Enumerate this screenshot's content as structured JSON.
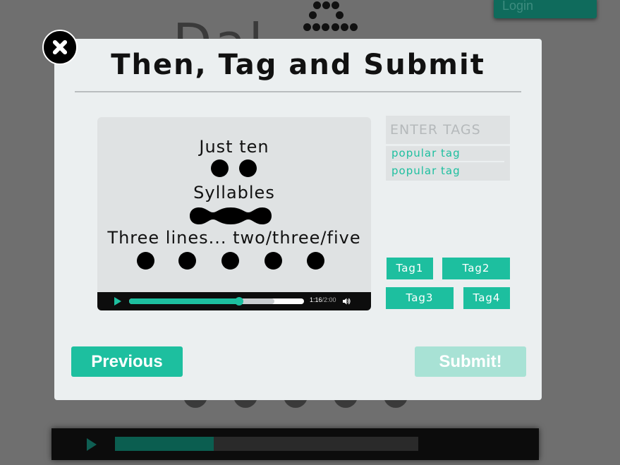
{
  "background": {
    "logo_text": "Dal",
    "login_button": "Login"
  },
  "modal": {
    "title": "Then, Tag and Submit",
    "close_icon": "close-icon"
  },
  "video": {
    "line1": "Just ten",
    "line2": "Syllables",
    "line3": "Three lines... two/three/five",
    "current_time": "1:16",
    "duration": "/2:00",
    "progress_fraction": 0.63,
    "buffered_fraction": 0.83
  },
  "tags": {
    "input_placeholder": "ENTER TAGS",
    "suggestions": [
      "popular tag",
      "popular tag"
    ],
    "buttons": [
      "Tag1",
      "Tag2",
      "Tag3",
      "Tag4"
    ]
  },
  "actions": {
    "previous_label": "Previous",
    "submit_label": "Submit!"
  },
  "colors": {
    "accent": "#1dbf9f",
    "accent_disabled": "#a8e2d5",
    "overlay": "#6f6f6f",
    "modal_bg": "#ebeff0"
  }
}
